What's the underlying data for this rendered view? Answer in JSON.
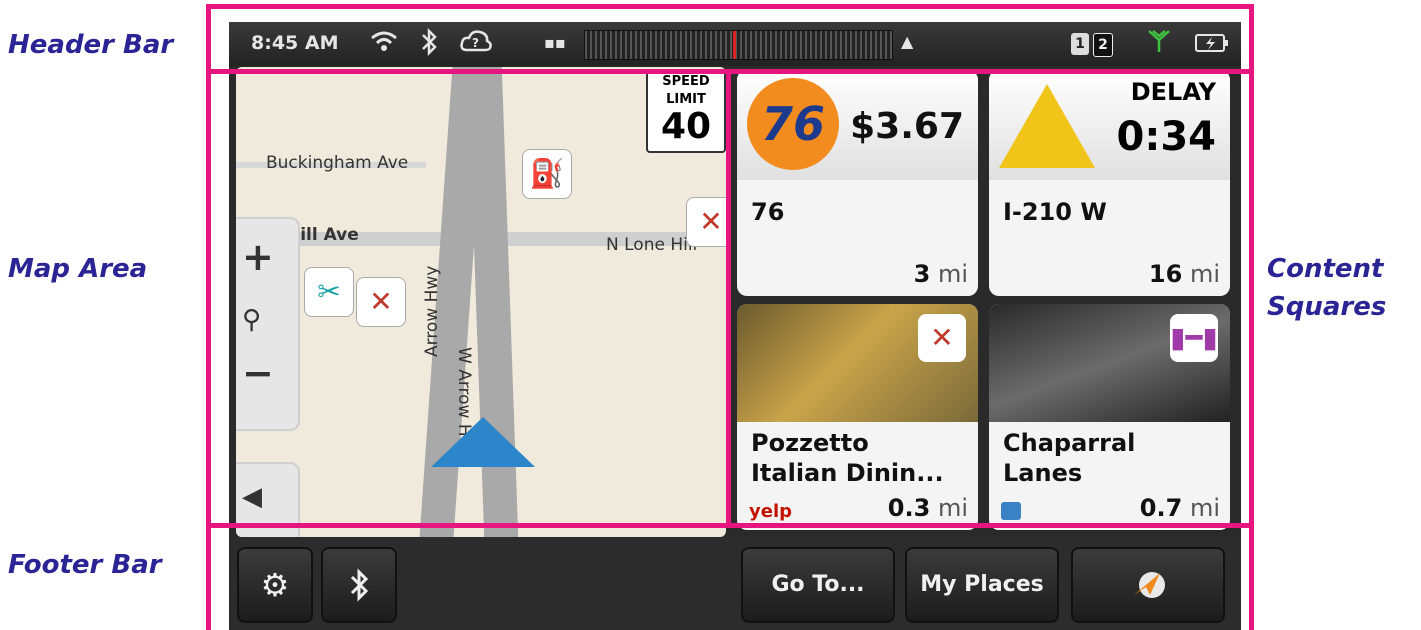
{
  "callouts": {
    "header": "Header Bar",
    "map": "Map Area",
    "content_line1": "Content",
    "content_line2": "Squares",
    "footer": "Footer Bar"
  },
  "header": {
    "time": "8:45 AM",
    "icons": [
      "wifi-icon",
      "bluetooth-icon",
      "cloud-help-icon",
      "grid-icon",
      "up-arrow-icon",
      "signal-icon",
      "battery-icon"
    ],
    "pages": [
      "1",
      "2"
    ]
  },
  "map": {
    "streets": [
      "Buckingham Ave",
      "Hill Ave",
      "N Lone Hill",
      "W Arrow Hwy",
      "Arrow Hwy"
    ],
    "speed_limit_label_1": "SPEED",
    "speed_limit_label_2": "LIMIT",
    "speed_limit_value": "40"
  },
  "tiles": [
    {
      "name": "76",
      "price": "$3.67",
      "distance": "3",
      "unit": "mi",
      "logo": "76"
    },
    {
      "name": "I-210 W",
      "delay_label": "DELAY",
      "delay_value": "0:34",
      "distance": "16",
      "unit": "mi"
    },
    {
      "name_line1": "Pozzetto",
      "name_line2": "Italian Dinin...",
      "distance": "0.3",
      "unit": "mi",
      "source": "yelp"
    },
    {
      "name_line1": "Chaparral",
      "name_line2": "Lanes",
      "distance": "0.7",
      "unit": "mi"
    }
  ],
  "footer": {
    "goto": "Go To...",
    "myplaces": "My Places"
  },
  "colors": {
    "highlight": "#e6157f",
    "callout": "#2b2494",
    "gas_logo": "#f28c1e",
    "arrow": "#2d86c9"
  }
}
